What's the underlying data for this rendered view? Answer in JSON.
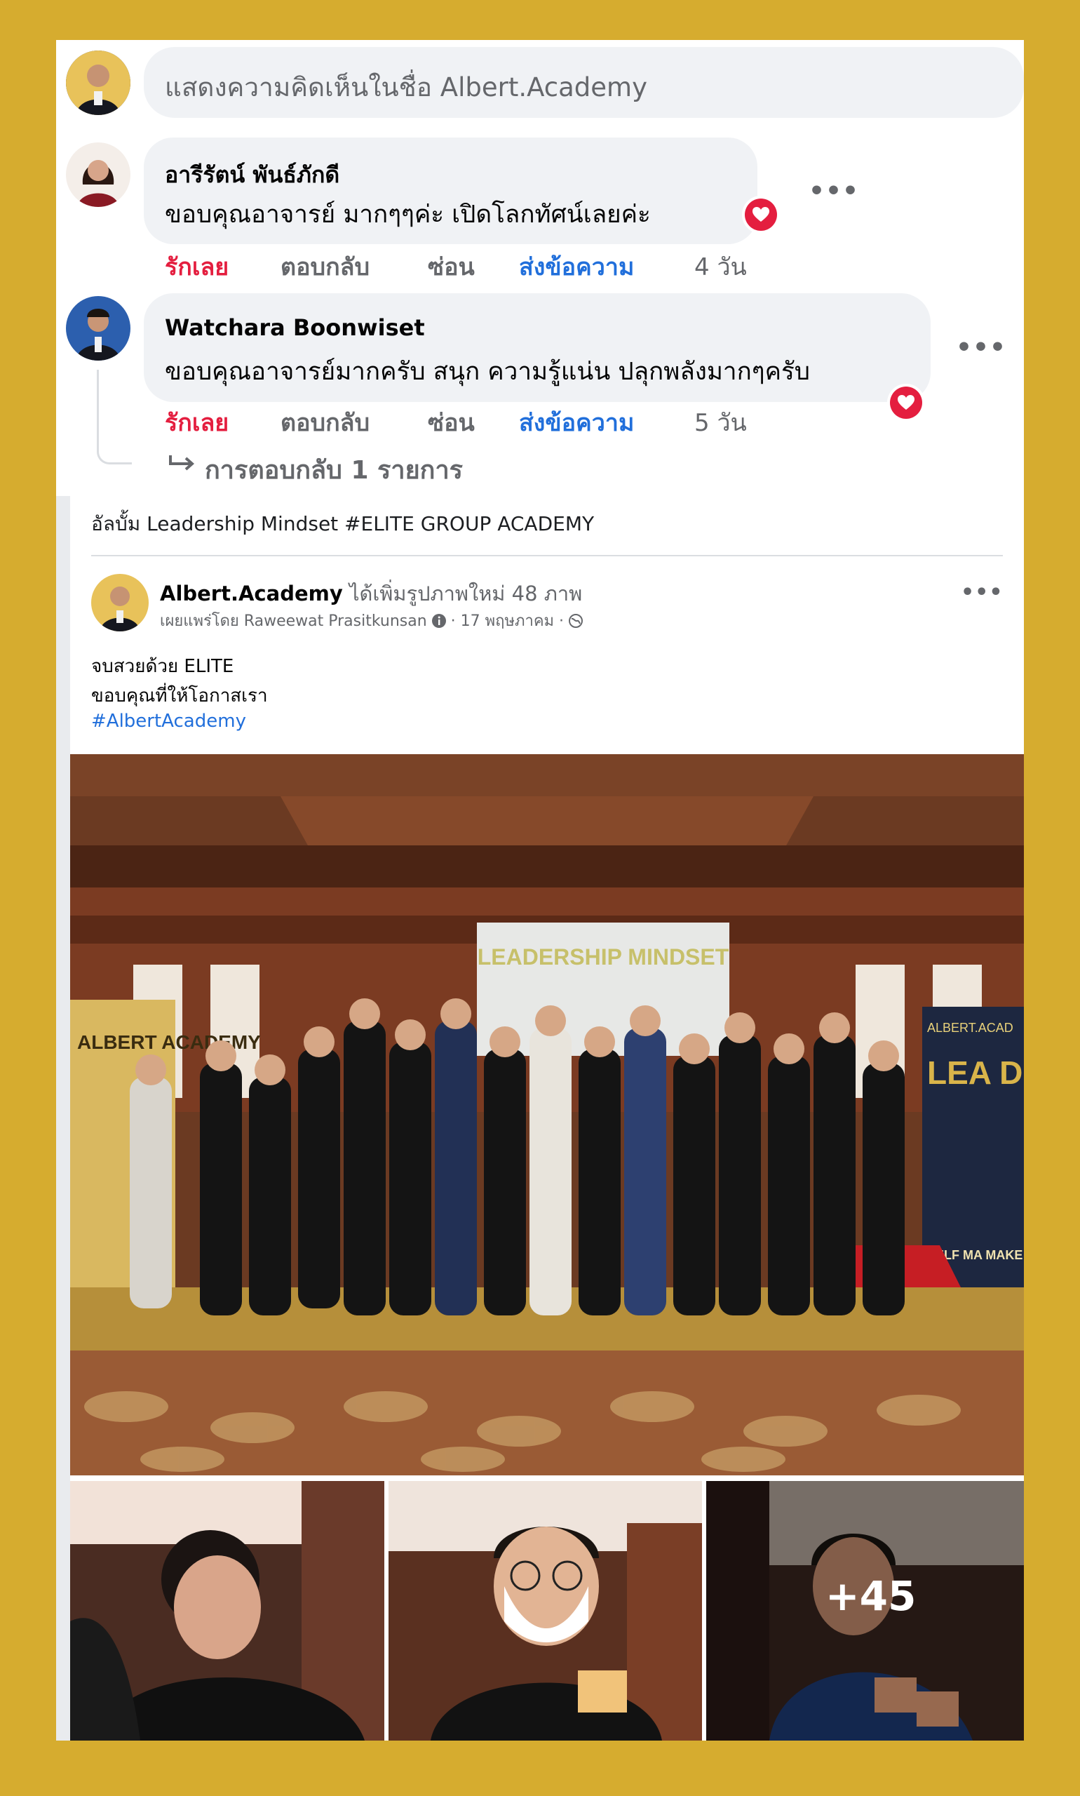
{
  "comment_box": {
    "placeholder": "แสดงความคิดเห็นในชื่อ Albert.Academy"
  },
  "comments": [
    {
      "name": "อารีรัตน์ พันธ์ภักดี",
      "text": "ขอบคุณอาจารย์ มากๆๆค่ะ เปิดโลกทัศน์เลยค่ะ",
      "actions": {
        "like": "รักเลย",
        "reply": "ตอบกลับ",
        "hide": "ซ่อน",
        "message": "ส่งข้อความ",
        "time": "4 วัน"
      }
    },
    {
      "name": "Watchara Boonwiset",
      "text": "ขอบคุณอาจารย์มากครับ สนุก ความรู้แน่น ปลุกพลังมากๆครับ",
      "actions": {
        "like": "รักเลย",
        "reply": "ตอบกลับ",
        "hide": "ซ่อน",
        "message": "ส่งข้อความ",
        "time": "5 วัน"
      }
    }
  ],
  "replies_link": "การตอบกลับ 1 รายการ",
  "album": {
    "label": "อัลบั้ม Leadership Mindset #ELITE GROUP ACADEMY"
  },
  "post": {
    "author": "Albert.Academy",
    "action": "ได้เพิ่มรูปภาพใหม่ 48 ภาพ",
    "published_by": "เผยแพร่โดย Raweewat Prasitkunsan",
    "date": "· 17 พฤษภาคม ·",
    "lines": [
      "จบสวยด้วย ELITE",
      "ขอบคุณที่ให้โอกาสเรา"
    ],
    "hashtag": "#AlbertAcademy",
    "more_photos": "+45"
  },
  "photo_text": {
    "screen": "LEADERSHIP MINDSET",
    "banner_left": "ALBERT ACADEMY",
    "banner_right_brand": "ALBERT.ACAD",
    "banner_right_big": "LEA D SH",
    "banner_right_small": "SELF MA MAKE W MASTERY"
  },
  "colors": {
    "frame": "#d6ac2f",
    "like": "#e41e3f",
    "link": "#216fdb",
    "muted": "#65676b"
  },
  "icons": [
    "avatar",
    "heart-icon",
    "more-icon",
    "reply-arrow-icon",
    "info-icon",
    "globe-icon"
  ]
}
